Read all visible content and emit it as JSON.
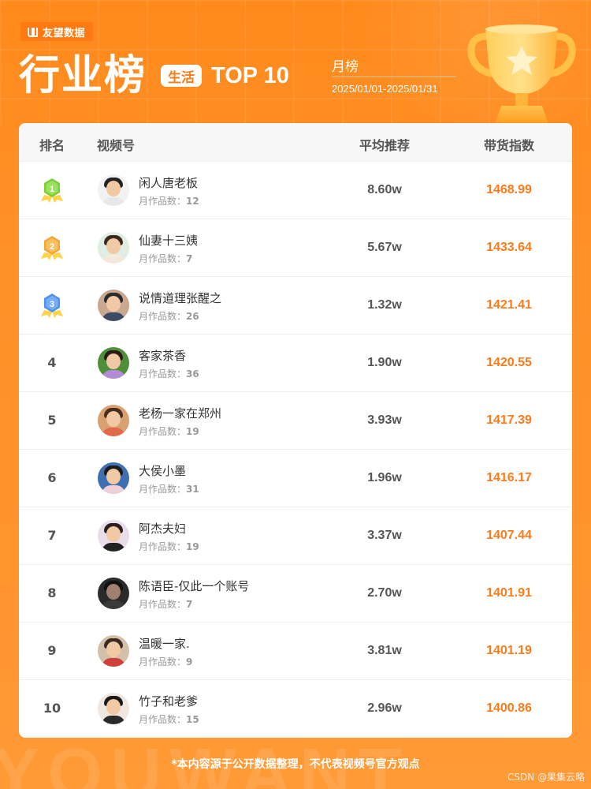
{
  "brand": {
    "name": "友望数据"
  },
  "header": {
    "title": "行业榜",
    "category": "生活",
    "top_label": "TOP 10",
    "period": "月榜",
    "date_range": "2025/01/01-2025/01/31"
  },
  "table": {
    "headers": {
      "rank": "排名",
      "name": "视频号",
      "avg": "平均推荐",
      "index": "带货指数"
    },
    "works_label": "月作品数：",
    "rows": [
      {
        "rank": "1",
        "name": "闲人唐老板",
        "works": "12",
        "avg": "8.60w",
        "index": "1468.99",
        "medal": "gold"
      },
      {
        "rank": "2",
        "name": "仙妻十三姨",
        "works": "7",
        "avg": "5.67w",
        "index": "1433.64",
        "medal": "silver"
      },
      {
        "rank": "3",
        "name": "说情道理张醒之",
        "works": "26",
        "avg": "1.32w",
        "index": "1421.41",
        "medal": "bronze"
      },
      {
        "rank": "4",
        "name": "客家茶香",
        "works": "36",
        "avg": "1.90w",
        "index": "1420.55"
      },
      {
        "rank": "5",
        "name": "老杨一家在郑州",
        "works": "19",
        "avg": "3.93w",
        "index": "1417.39"
      },
      {
        "rank": "6",
        "name": "大侯小墨",
        "works": "31",
        "avg": "1.96w",
        "index": "1416.17"
      },
      {
        "rank": "7",
        "name": "阿杰夫妇",
        "works": "19",
        "avg": "3.37w",
        "index": "1407.44"
      },
      {
        "rank": "8",
        "name": "陈语臣-仅此一个账号",
        "works": "7",
        "avg": "2.70w",
        "index": "1401.91"
      },
      {
        "rank": "9",
        "name": "温暖一家.",
        "works": "9",
        "avg": "3.81w",
        "index": "1401.19"
      },
      {
        "rank": "10",
        "name": "竹子和老爹",
        "works": "15",
        "avg": "2.96w",
        "index": "1400.86"
      }
    ]
  },
  "footer": {
    "disclaimer": "*本内容源于公开数据整理，不代表视频号官方观点",
    "watermark": "YOUWANT",
    "source_tag": "CSDN @果集云略"
  },
  "colors": {
    "background": "#ff8a1c",
    "accent": "#ff7a1a",
    "medal_gold": "#7ccf3a",
    "medal_silver": "#f4a637",
    "medal_bronze": "#4f93f0"
  }
}
